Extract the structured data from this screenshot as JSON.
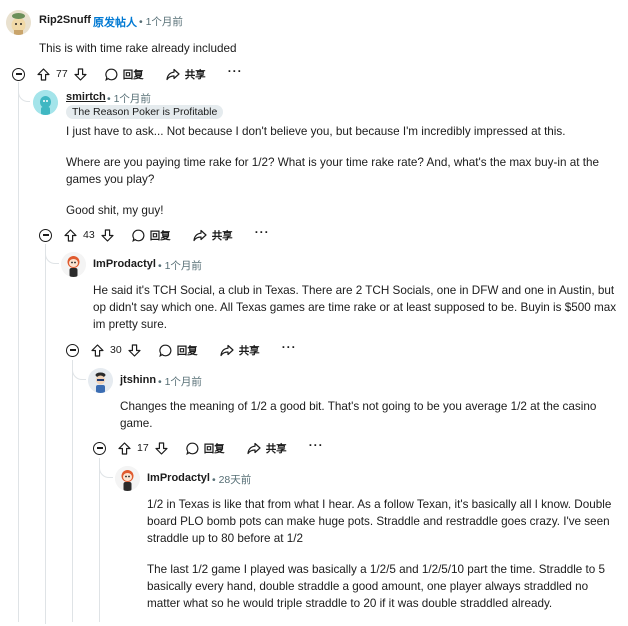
{
  "comments": [
    {
      "username": "Rip2Snuff",
      "op_badge": "原发帖人",
      "time": "• 1个月前",
      "paragraphs": [
        "This is with time rake already included"
      ],
      "votes": "77"
    },
    {
      "username": "smirtch",
      "time": "• 1个月前",
      "flair": "The Reason Poker is Profitable",
      "paragraphs": [
        "I just have to ask... Not because I don't believe you, but because I'm incredibly impressed at this.",
        "Where are you paying time rake for 1/2? What is your time rake rate? And, what's the max buy-in at the games you play?",
        "Good shit, my guy!"
      ],
      "votes": "43"
    },
    {
      "username": "ImProdactyl",
      "time": "• 1个月前",
      "paragraphs": [
        "He said it's TCH Social, a club in Texas. There are 2 TCH Socials, one in DFW and one in Austin, but op didn't say which one. All Texas games are time rake or at least supposed to be. Buyin is $500 max im pretty sure."
      ],
      "votes": "30"
    },
    {
      "username": "jtshinn",
      "time": "• 1个月前",
      "paragraphs": [
        "Changes the meaning of 1/2 a good bit. That's not going to be you average 1/2 at the casino game."
      ],
      "votes": "17"
    },
    {
      "username": "ImProdactyl",
      "time": "• 28天前",
      "paragraphs": [
        "1/2 in Texas is like that from what I hear. As a follow Texan, it's basically all I know. Double board PLO bomb pots can make huge pots. Straddle and restraddle goes crazy. I've seen straddle up to 80 before at 1/2",
        "The last 1/2 game I played was basically a 1/2/5 and 1/2/5/10 part the time. Straddle to 5 basically every hand, double straddle a good amount, one player always straddled no matter what so he would triple straddle to 20 if it was double straddled already."
      ]
    }
  ],
  "actions": {
    "reply_label": "回复",
    "share_label": "共享",
    "more_label": "···"
  },
  "colors": {
    "op_badge": "#0079d3",
    "meta": "#576f76",
    "thread_line": "#dfe3e6"
  }
}
